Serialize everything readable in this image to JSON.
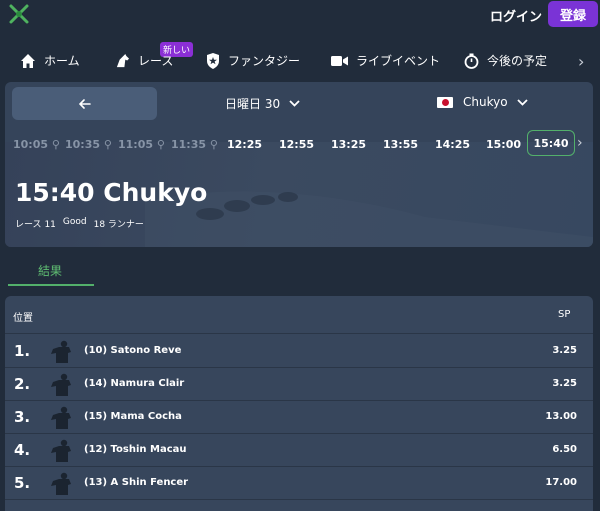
{
  "header": {
    "logo_icon": "crossed-swords-logo-icon",
    "login_label": "ログイン",
    "register_label": "登録",
    "accent_color": "#7a33d6"
  },
  "nav": {
    "items": [
      {
        "label": "ホーム",
        "icon": "home-icon"
      },
      {
        "label": "レース",
        "icon": "horse-icon",
        "badge": "新しい"
      },
      {
        "label": "ファンタジー",
        "icon": "shield-star-icon"
      },
      {
        "label": "ライブイベント",
        "icon": "video-camera-icon"
      },
      {
        "label": "今後の予定",
        "icon": "stopwatch-icon"
      }
    ]
  },
  "race_nav": {
    "back_icon": "arrow-left-icon",
    "day_label": "日曜日 30",
    "track_label": "Chukyo",
    "track_flag": "japan-flag-icon"
  },
  "times": {
    "past": [
      "10:05",
      "10:35",
      "11:05",
      "11:35"
    ],
    "future": [
      "12:25",
      "12:55",
      "13:25",
      "13:55",
      "14:25",
      "15:00"
    ],
    "active": "15:40",
    "active_color": "#53b06b"
  },
  "race": {
    "title": "15:40 Chukyo",
    "race_label": "レース",
    "race_number": "11",
    "going": "Good",
    "runners_count": "18",
    "runners_label": "ランナー"
  },
  "tabs": {
    "results_label": "結果"
  },
  "results": {
    "position_header": "位置",
    "sp_header": "SP",
    "rows": [
      {
        "position": "1.",
        "horse": "(10) Satono Reve",
        "sp": "3.25"
      },
      {
        "position": "2.",
        "horse": "(14) Namura Clair",
        "sp": "3.25"
      },
      {
        "position": "3.",
        "horse": "(15) Mama Cocha",
        "sp": "13.00"
      },
      {
        "position": "4.",
        "horse": "(12) Toshin Macau",
        "sp": "6.50"
      },
      {
        "position": "5.",
        "horse": "(13) A Shin Fencer",
        "sp": "17.00"
      }
    ]
  }
}
